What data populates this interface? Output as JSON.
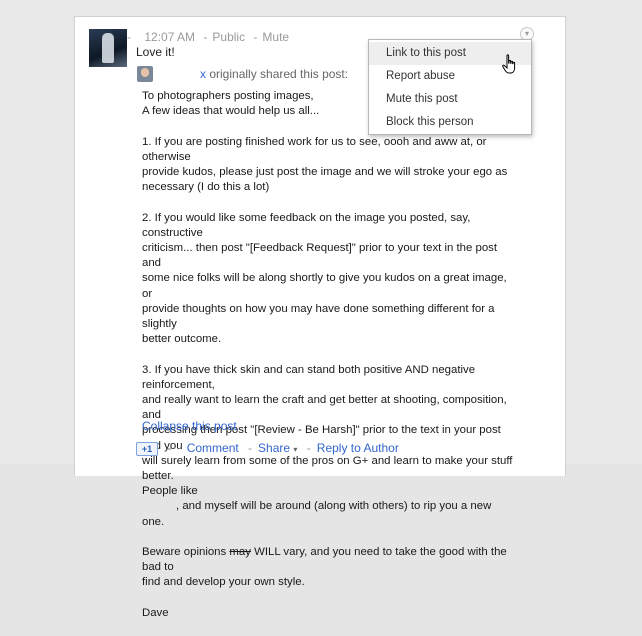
{
  "post": {
    "time": "12:07 AM",
    "visibility": "Public",
    "mute_label": "Mute",
    "comment": "Love it!",
    "shared_suffix": "originally shared this post:",
    "shared_prefix_fragment": "x",
    "paragraphs": {
      "p1": [
        "To photographers posting images,",
        "A few ideas that would help us all..."
      ],
      "p2": [
        "1. If you are posting finished work for us to see, oooh and aww at, or otherwise",
        "provide kudos, please just post the image and we will stroke your ego as",
        "necessary (I do this a lot)"
      ],
      "p3": [
        "2. If you would like some feedback on the image you posted, say, constructive",
        "criticism... then post \"[Feedback Request]\" prior to your text in the post and",
        "some nice folks will be along shortly to give you kudos on a great image, or",
        "provide thoughts on how you may have done something different for a slightly",
        "better outcome."
      ],
      "p4": [
        "3. If you have thick skin and can stand both positive AND negative reinforcement,",
        "and really want to learn the craft and get better at shooting, composition, and",
        "processing then post \"[Review - Be Harsh]\" prior to the text in your post and you",
        "will surely learn from some of the pros on G+ and learn to make your stuff better.",
        "People like",
        ", and myself will be around (along with others) to rip you a new one."
      ],
      "p5_a": "Beware opinions ",
      "p5_strike": "may",
      "p5_b": " WILL vary, and you need to take the good with the bad to",
      "p5_c": "find and develop your own style.",
      "signature": "Dave"
    },
    "collapse_label": "Collapse this post"
  },
  "actions": {
    "plusone": "+1",
    "comment": "Comment",
    "share": "Share",
    "share_caret": "▾",
    "reply": "Reply to Author",
    "dot": "-"
  },
  "menu": {
    "trigger_icon": "chevron-down-icon",
    "items": [
      "Link to this post",
      "Report abuse",
      "Mute this post",
      "Block this person"
    ],
    "hovered_index": 0
  }
}
